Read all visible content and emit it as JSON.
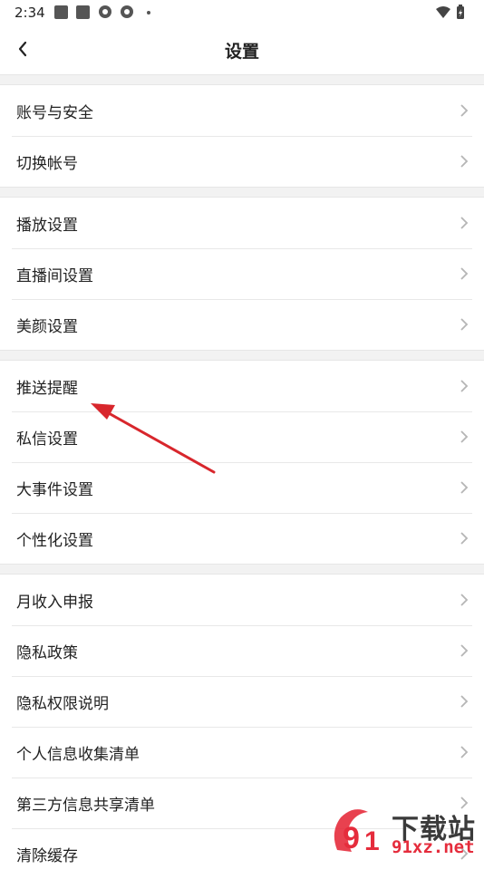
{
  "status_bar": {
    "time": "2:34"
  },
  "header": {
    "title": "设置"
  },
  "groups": [
    {
      "items": [
        {
          "label": "账号与安全"
        },
        {
          "label": "切换帐号"
        }
      ]
    },
    {
      "items": [
        {
          "label": "播放设置"
        },
        {
          "label": "直播间设置"
        },
        {
          "label": "美颜设置"
        }
      ]
    },
    {
      "items": [
        {
          "label": "推送提醒"
        },
        {
          "label": "私信设置"
        },
        {
          "label": "大事件设置"
        },
        {
          "label": "个性化设置"
        }
      ]
    },
    {
      "items": [
        {
          "label": "月收入申报"
        },
        {
          "label": "隐私政策"
        },
        {
          "label": "隐私权限说明"
        },
        {
          "label": "个人信息收集清单"
        },
        {
          "label": "第三方信息共享清单"
        },
        {
          "label": "清除缓存"
        }
      ]
    }
  ],
  "annotation": {
    "arrow_color": "#d8262c"
  },
  "watermark": {
    "top_text": "下载站",
    "bottom_text": "91xz.net",
    "accent": "#e52c3c"
  }
}
